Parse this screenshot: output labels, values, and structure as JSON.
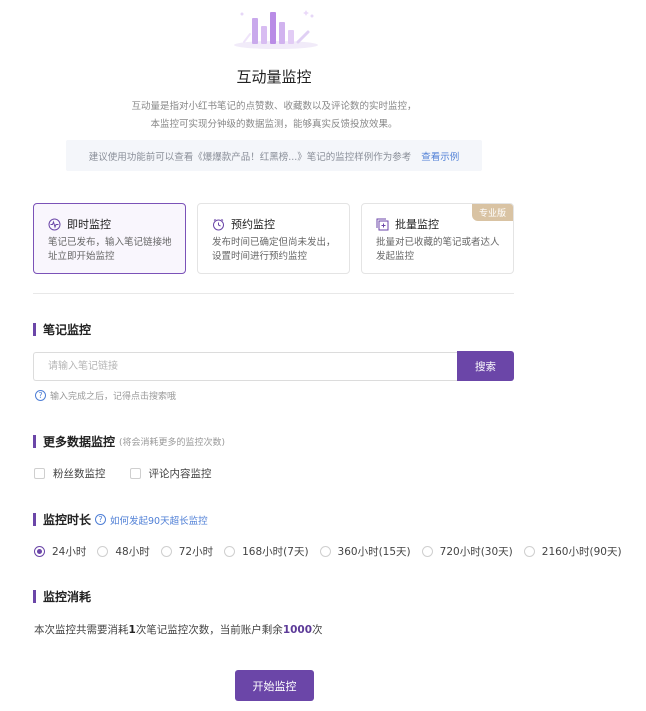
{
  "header": {
    "title": "互动量监控",
    "desc_line1": "互动量是指对小红书笔记的点赞数、收藏数以及评论数的实时监控，",
    "desc_line2": "本监控可实现分钟级的数据监测，能够真实反馈投放效果。"
  },
  "tip": {
    "text": "建议使用功能前可以查看《爆爆款产品！红黑榜...》笔记的监控样例作为参考",
    "link": "查看示例"
  },
  "modes": [
    {
      "title": "即时监控",
      "desc": "笔记已发布，输入笔记链接地 址立即开始监控",
      "active": true,
      "icon": "pulse-icon"
    },
    {
      "title": "预约监控",
      "desc": "发布时间已确定但尚未发出，设置时间进行预约监控",
      "active": false,
      "icon": "clock-icon"
    },
    {
      "title": "批量监控",
      "desc": "批量对已收藏的笔记或者达人发起监控",
      "active": false,
      "icon": "batch-add-icon",
      "badge": "专业版"
    }
  ],
  "note_section": {
    "title": "笔记监控",
    "placeholder": "请输入笔记链接",
    "search_label": "搜索",
    "hint": "输入完成之后，记得点击搜索哦"
  },
  "more_section": {
    "title": "更多数据监控",
    "subtitle": "(将会消耗更多的监控次数)",
    "options": [
      "粉丝数监控",
      "评论内容监控"
    ]
  },
  "duration_section": {
    "title": "监控时长",
    "help": "如何发起90天超长监控",
    "options": [
      "24小时",
      "48小时",
      "72小时",
      "168小时(7天)",
      "360小时(15天)",
      "720小时(30天)",
      "2160小时(90天)"
    ],
    "selected": "24小时"
  },
  "cost_section": {
    "title": "监控消耗",
    "prefix": "本次监控共需要消耗",
    "count": "1",
    "middle": "次笔记监控次数，当前账户剩余",
    "remain": "1000",
    "suffix": "次"
  },
  "start_label": "开始监控",
  "colors": {
    "accent": "#6b46a8",
    "link": "#4f7fd6",
    "badge": "#d9c3a3"
  }
}
